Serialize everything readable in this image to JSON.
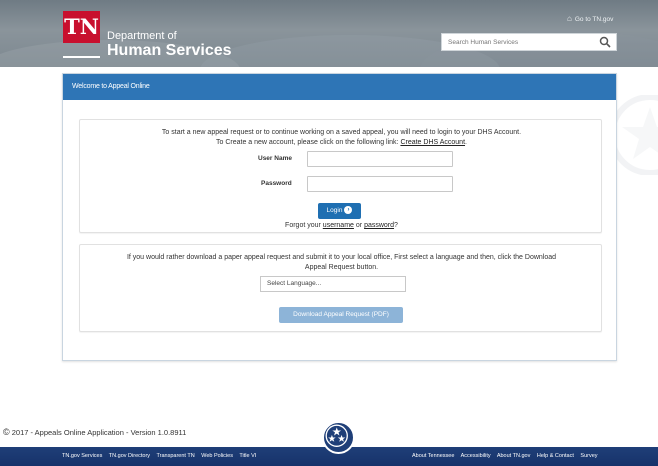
{
  "header": {
    "logo_text": "TN",
    "dept_line1": "Department of",
    "dept_line2": "Human Services",
    "goto_link": "Go to TN.gov",
    "search_placeholder": "Search Human Services"
  },
  "welcome": {
    "title": "Welcome to Appeal Online"
  },
  "login_panel": {
    "intro_line1": "To start a new appeal request or to continue working on a saved appeal, you will need to login to your DHS Account.",
    "intro_line2_prefix": "To Create a new account, please click on the following link: ",
    "create_account_link": "Create DHS Account",
    "intro_line2_suffix": ".",
    "username_label": "User Name",
    "password_label": "Password",
    "login_button": "Login",
    "forgot_prefix": "Forgot your ",
    "forgot_username": "username",
    "forgot_or": " or ",
    "forgot_password": "password",
    "forgot_suffix": "?"
  },
  "download_panel": {
    "intro_line1": "If you would rather download a paper appeal request and submit it to your local office, First select a language and then, click the Download",
    "intro_line2": "Appeal Request button.",
    "language_select": "Select Language...",
    "download_button": "Download Appeal Request (PDF)"
  },
  "footer": {
    "copyright": "2017 - Appeals Online Application - Version 1.0.8911",
    "left_links": [
      "TN.gov Services",
      "TN.gov Directory",
      "Transparent TN",
      "Web Policies",
      "Title VI"
    ],
    "right_links": [
      "About Tennessee",
      "Accessibility",
      "About TN.gov",
      "Help & Contact",
      "Survey"
    ]
  },
  "colors": {
    "header_bg": "#7d8890",
    "tn_red": "#c8102e",
    "welcome_blue": "#2e75b6",
    "login_button": "#1f6fb2",
    "download_button": "#8db4d8",
    "footer_bg": "#1f3f78"
  }
}
